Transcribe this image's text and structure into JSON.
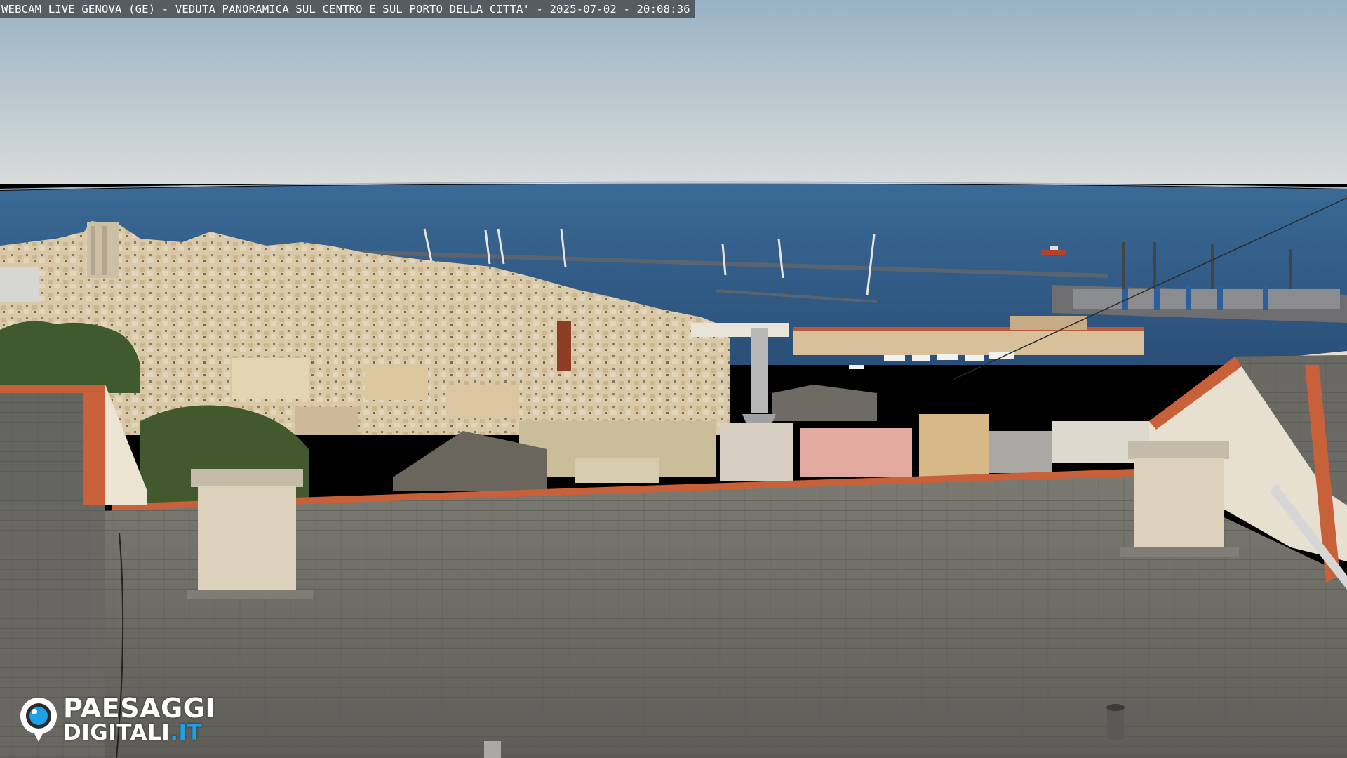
{
  "overlay": {
    "caption": "WEBCAM LIVE GENOVA (GE) - VEDUTA PANORAMICA SUL CENTRO E SUL PORTO DELLA CITTA' - 2025-07-02 - 20:08:36"
  },
  "logo": {
    "line1": "PAESAGGI",
    "line2_main": "DIGITALI",
    "line2_tld": ".IT",
    "icon": "camera-lens-icon",
    "accent_color": "#1ea0e6"
  },
  "colors": {
    "sky_top": "#9fb6c6",
    "sky_horizon": "#d5dbdc",
    "sea": "#2f5a86",
    "roof": "#6b6a64",
    "terracotta": "#c8603a"
  }
}
